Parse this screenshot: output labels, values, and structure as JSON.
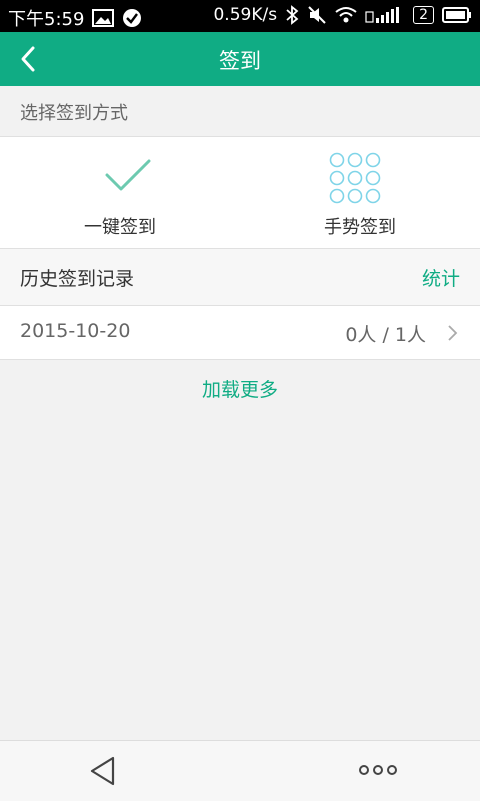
{
  "status_bar": {
    "time": "下午5:59",
    "speed": "0.59K/s",
    "sim_count": "2",
    "icons": [
      "image-icon",
      "check-circle-icon",
      "bluetooth-icon",
      "mute-icon",
      "wifi-icon",
      "signal-icon",
      "battery-icon"
    ]
  },
  "header": {
    "title": "签到",
    "back_icon": "back-arrow-icon"
  },
  "section": {
    "choose_method_label": "选择签到方式"
  },
  "methods": [
    {
      "label": "一键签到",
      "icon": "checkmark-icon"
    },
    {
      "label": "手势签到",
      "icon": "gesture-grid-icon"
    }
  ],
  "history": {
    "title": "历史签到记录",
    "stats_link": "统计",
    "records": [
      {
        "date": "2015-10-20",
        "count": "0人 / 1人"
      }
    ],
    "load_more": "加载更多"
  },
  "colors": {
    "accent": "#10ac84",
    "background": "#f2f2f2"
  }
}
